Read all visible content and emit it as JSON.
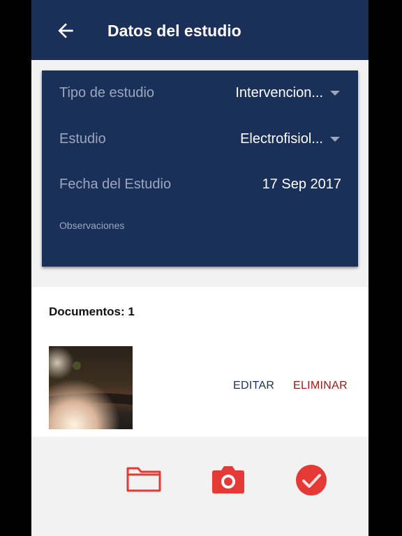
{
  "appbar": {
    "title": "Datos del estudio",
    "back_icon": "arrow-left-icon"
  },
  "form": {
    "tipo_label": "Tipo de estudio",
    "tipo_value": "Intervencion...",
    "estudio_label": "Estudio",
    "estudio_value": "Electrofisiol...",
    "fecha_label": "Fecha del Estudio",
    "fecha_value": "17 Sep 2017",
    "observaciones_label": "Observaciones"
  },
  "documents": {
    "title": "Documentos: 1",
    "edit_label": "EDITAR",
    "delete_label": "ELIMINAR"
  },
  "actions": {
    "folder_icon": "folder-icon",
    "camera_icon": "camera-icon",
    "confirm_icon": "check-icon"
  },
  "colors": {
    "primary": "#1b3058",
    "accent": "#e53935",
    "delete": "#a01818"
  }
}
